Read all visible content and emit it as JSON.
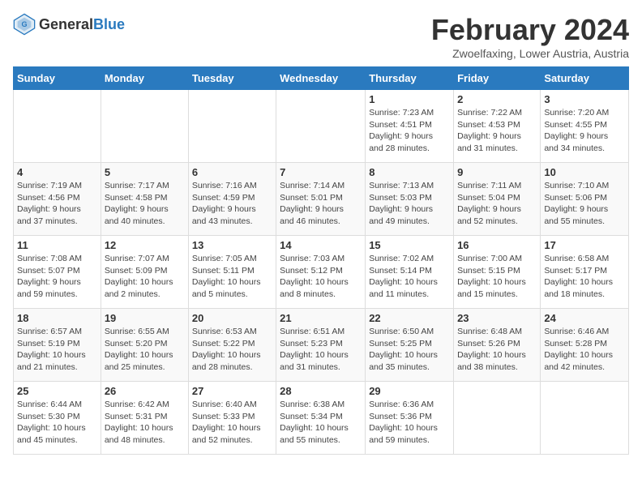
{
  "header": {
    "logo_general": "General",
    "logo_blue": "Blue",
    "title": "February 2024",
    "subtitle": "Zwoelfaxing, Lower Austria, Austria"
  },
  "columns": [
    "Sunday",
    "Monday",
    "Tuesday",
    "Wednesday",
    "Thursday",
    "Friday",
    "Saturday"
  ],
  "rows": [
    [
      {
        "day": "",
        "info": ""
      },
      {
        "day": "",
        "info": ""
      },
      {
        "day": "",
        "info": ""
      },
      {
        "day": "",
        "info": ""
      },
      {
        "day": "1",
        "info": "Sunrise: 7:23 AM\nSunset: 4:51 PM\nDaylight: 9 hours\nand 28 minutes."
      },
      {
        "day": "2",
        "info": "Sunrise: 7:22 AM\nSunset: 4:53 PM\nDaylight: 9 hours\nand 31 minutes."
      },
      {
        "day": "3",
        "info": "Sunrise: 7:20 AM\nSunset: 4:55 PM\nDaylight: 9 hours\nand 34 minutes."
      }
    ],
    [
      {
        "day": "4",
        "info": "Sunrise: 7:19 AM\nSunset: 4:56 PM\nDaylight: 9 hours\nand 37 minutes."
      },
      {
        "day": "5",
        "info": "Sunrise: 7:17 AM\nSunset: 4:58 PM\nDaylight: 9 hours\nand 40 minutes."
      },
      {
        "day": "6",
        "info": "Sunrise: 7:16 AM\nSunset: 4:59 PM\nDaylight: 9 hours\nand 43 minutes."
      },
      {
        "day": "7",
        "info": "Sunrise: 7:14 AM\nSunset: 5:01 PM\nDaylight: 9 hours\nand 46 minutes."
      },
      {
        "day": "8",
        "info": "Sunrise: 7:13 AM\nSunset: 5:03 PM\nDaylight: 9 hours\nand 49 minutes."
      },
      {
        "day": "9",
        "info": "Sunrise: 7:11 AM\nSunset: 5:04 PM\nDaylight: 9 hours\nand 52 minutes."
      },
      {
        "day": "10",
        "info": "Sunrise: 7:10 AM\nSunset: 5:06 PM\nDaylight: 9 hours\nand 55 minutes."
      }
    ],
    [
      {
        "day": "11",
        "info": "Sunrise: 7:08 AM\nSunset: 5:07 PM\nDaylight: 9 hours\nand 59 minutes."
      },
      {
        "day": "12",
        "info": "Sunrise: 7:07 AM\nSunset: 5:09 PM\nDaylight: 10 hours\nand 2 minutes."
      },
      {
        "day": "13",
        "info": "Sunrise: 7:05 AM\nSunset: 5:11 PM\nDaylight: 10 hours\nand 5 minutes."
      },
      {
        "day": "14",
        "info": "Sunrise: 7:03 AM\nSunset: 5:12 PM\nDaylight: 10 hours\nand 8 minutes."
      },
      {
        "day": "15",
        "info": "Sunrise: 7:02 AM\nSunset: 5:14 PM\nDaylight: 10 hours\nand 11 minutes."
      },
      {
        "day": "16",
        "info": "Sunrise: 7:00 AM\nSunset: 5:15 PM\nDaylight: 10 hours\nand 15 minutes."
      },
      {
        "day": "17",
        "info": "Sunrise: 6:58 AM\nSunset: 5:17 PM\nDaylight: 10 hours\nand 18 minutes."
      }
    ],
    [
      {
        "day": "18",
        "info": "Sunrise: 6:57 AM\nSunset: 5:19 PM\nDaylight: 10 hours\nand 21 minutes."
      },
      {
        "day": "19",
        "info": "Sunrise: 6:55 AM\nSunset: 5:20 PM\nDaylight: 10 hours\nand 25 minutes."
      },
      {
        "day": "20",
        "info": "Sunrise: 6:53 AM\nSunset: 5:22 PM\nDaylight: 10 hours\nand 28 minutes."
      },
      {
        "day": "21",
        "info": "Sunrise: 6:51 AM\nSunset: 5:23 PM\nDaylight: 10 hours\nand 31 minutes."
      },
      {
        "day": "22",
        "info": "Sunrise: 6:50 AM\nSunset: 5:25 PM\nDaylight: 10 hours\nand 35 minutes."
      },
      {
        "day": "23",
        "info": "Sunrise: 6:48 AM\nSunset: 5:26 PM\nDaylight: 10 hours\nand 38 minutes."
      },
      {
        "day": "24",
        "info": "Sunrise: 6:46 AM\nSunset: 5:28 PM\nDaylight: 10 hours\nand 42 minutes."
      }
    ],
    [
      {
        "day": "25",
        "info": "Sunrise: 6:44 AM\nSunset: 5:30 PM\nDaylight: 10 hours\nand 45 minutes."
      },
      {
        "day": "26",
        "info": "Sunrise: 6:42 AM\nSunset: 5:31 PM\nDaylight: 10 hours\nand 48 minutes."
      },
      {
        "day": "27",
        "info": "Sunrise: 6:40 AM\nSunset: 5:33 PM\nDaylight: 10 hours\nand 52 minutes."
      },
      {
        "day": "28",
        "info": "Sunrise: 6:38 AM\nSunset: 5:34 PM\nDaylight: 10 hours\nand 55 minutes."
      },
      {
        "day": "29",
        "info": "Sunrise: 6:36 AM\nSunset: 5:36 PM\nDaylight: 10 hours\nand 59 minutes."
      },
      {
        "day": "",
        "info": ""
      },
      {
        "day": "",
        "info": ""
      }
    ]
  ]
}
